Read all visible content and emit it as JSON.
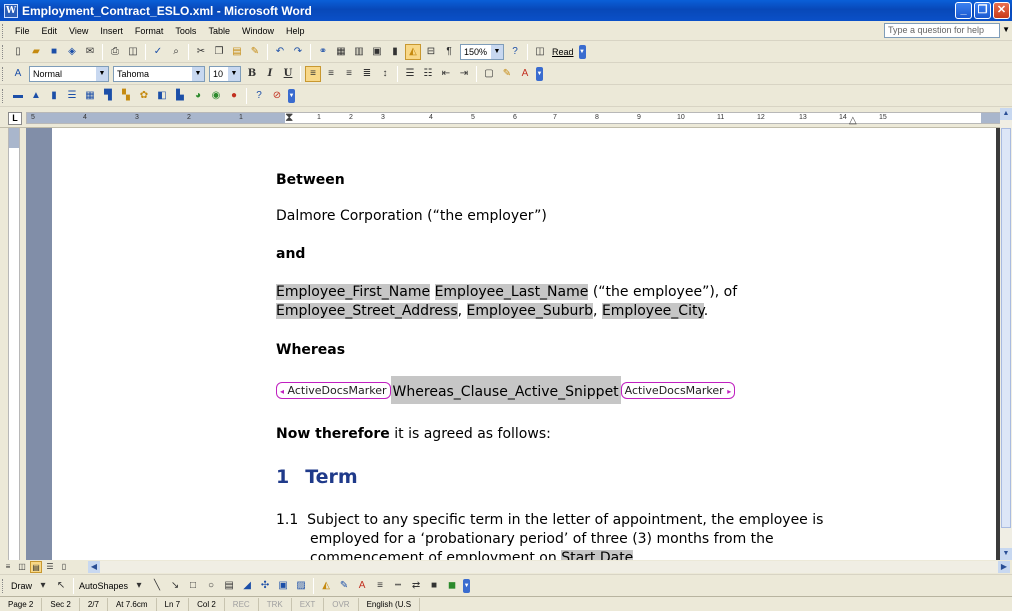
{
  "window": {
    "title": "Employment_Contract_ESLO.xml - Microsoft Word",
    "minimize": "_",
    "maximize": "❐",
    "close": "✕"
  },
  "menu": {
    "items": [
      "File",
      "Edit",
      "View",
      "Insert",
      "Format",
      "Tools",
      "Table",
      "Window",
      "Help"
    ],
    "help_placeholder": "Type a question for help"
  },
  "toolbar": {
    "zoom": "150%",
    "read_label": "Read",
    "style": "Normal",
    "font": "Tahoma",
    "font_size": "10",
    "bold": "B",
    "italic": "I",
    "underline": "U"
  },
  "ruler": {
    "tab_selector": "L",
    "labels": [
      "5",
      "4",
      "3",
      "2",
      "1",
      "1",
      "2",
      "3",
      "4",
      "5",
      "6",
      "7",
      "8",
      "9",
      "10",
      "11",
      "12",
      "13",
      "14",
      "15"
    ]
  },
  "document": {
    "between": "Between",
    "employer_line": "Dalmore Corporation (“the employer”)",
    "and": "and",
    "emp_first": "Employee_First_Name",
    "emp_last": "Employee_Last_Name",
    "emp_tail": " (“the employee”), of",
    "emp_street": "Employee_Street_Address",
    "emp_suburb": "Employee_Suburb",
    "emp_city": "Employee_City",
    "whereas": "Whereas",
    "marker_open": "ActiveDocsMarker",
    "snippet": "Whereas_Clause_Active_Snippet",
    "marker_close": "ActiveDocsMarker",
    "now_bold": "Now therefore",
    "now_rest": " it is agreed as follows:",
    "heading_num": "1",
    "heading_text": "Term",
    "clause_num": "1.1",
    "clause_line1": "Subject to any specific term in the letter of appointment, the employee is",
    "clause_line2": "employed for a ‘probationary period’ of three (3) months from the",
    "clause_line3_a": "commencement of employment on ",
    "clause_line3_b": "Start Date"
  },
  "drawing_toolbar": {
    "draw": "Draw",
    "autoshapes": "AutoShapes"
  },
  "status": {
    "page": "Page 2",
    "sec": "Sec 2",
    "pos": "2/7",
    "at": "At 7.6cm",
    "ln": "Ln 7",
    "col": "Col 2",
    "rec": "REC",
    "trk": "TRK",
    "ext": "EXT",
    "ovr": "OVR",
    "lang": "English (U.S"
  }
}
